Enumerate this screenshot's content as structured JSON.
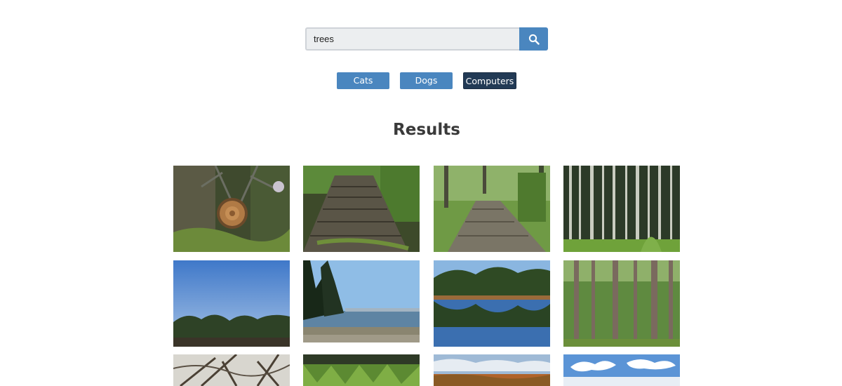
{
  "search": {
    "value": "trees",
    "placeholder": "",
    "button_icon": "search-icon",
    "accent": "#4a86bf"
  },
  "categories": [
    {
      "label": "Cats",
      "active": false
    },
    {
      "label": "Dogs",
      "active": false
    },
    {
      "label": "Computers",
      "active": true
    }
  ],
  "results": {
    "title": "Results",
    "images": [
      {
        "subject": "cut branch with tree rings"
      },
      {
        "subject": "wooden boardwalk in forest"
      },
      {
        "subject": "boardwalk through green woods"
      },
      {
        "subject": "dense birch forest"
      },
      {
        "subject": "blue sky over tree line"
      },
      {
        "subject": "pine trees at lake shore"
      },
      {
        "subject": "forest reflected in lake"
      },
      {
        "subject": "tall pine trunks"
      },
      {
        "subject": "bare tree canopy"
      },
      {
        "subject": "tall grass field"
      },
      {
        "subject": "autumn forest under clouds"
      },
      {
        "subject": "clouds over horizon"
      }
    ]
  },
  "colors": {
    "button": "#4a86bf",
    "button_active": "#223a55"
  }
}
